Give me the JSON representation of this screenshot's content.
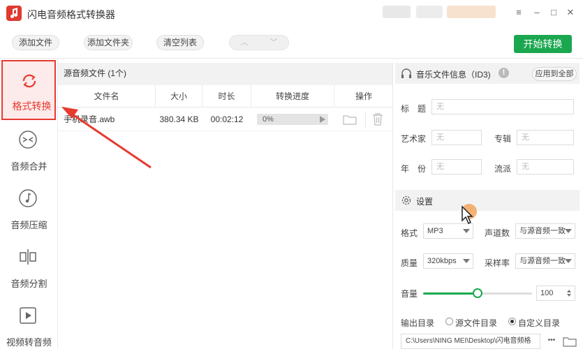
{
  "app": {
    "title": "闪电音频格式转换器"
  },
  "toolbar": {
    "add_file": "添加文件",
    "add_folder": "添加文件夹",
    "clear_list": "清空列表",
    "start": "开始转换"
  },
  "sidebar": {
    "items": [
      {
        "label": "格式转换",
        "icon": "refresh-icon"
      },
      {
        "label": "音频合并",
        "icon": "merge-icon"
      },
      {
        "label": "音频压缩",
        "icon": "music-note-icon"
      },
      {
        "label": "音频分割",
        "icon": "split-icon"
      },
      {
        "label": "视频转音频",
        "icon": "play-icon"
      }
    ]
  },
  "files": {
    "header": "源音频文件 (1个)",
    "columns": [
      "文件名",
      "大小",
      "时长",
      "转换进度",
      "操作"
    ],
    "rows": [
      {
        "name": "手机录音.awb",
        "size": "380.34 KB",
        "duration": "00:02:12",
        "progress": "0%"
      }
    ]
  },
  "info": {
    "title": "音乐文件信息（ID3)",
    "apply_all": "应用到全部",
    "title_label": "标　题",
    "artist_label": "艺术家",
    "album_label": "专辑",
    "year_label": "年　份",
    "genre_label": "流派",
    "empty": "无"
  },
  "settings": {
    "title": "设置",
    "format_label": "格式",
    "format_value": "MP3",
    "channels_label": "声道数",
    "channels_value": "与源音频一致",
    "quality_label": "质量",
    "quality_value": "320kbps",
    "samplerate_label": "采样率",
    "samplerate_value": "与源音频一致",
    "volume_label": "音量",
    "volume_value": "100",
    "volume_level": 0.5,
    "output_label": "输出目录",
    "output_opt1": "源文件目录",
    "output_opt2": "自定义目录",
    "output_path": "C:\\Users\\NING MEI\\Desktop\\闪电音频格",
    "more": "•••"
  },
  "colors": {
    "accent": "#1aa74f",
    "active": "#e63a2f",
    "logo": "#e03a2f"
  }
}
